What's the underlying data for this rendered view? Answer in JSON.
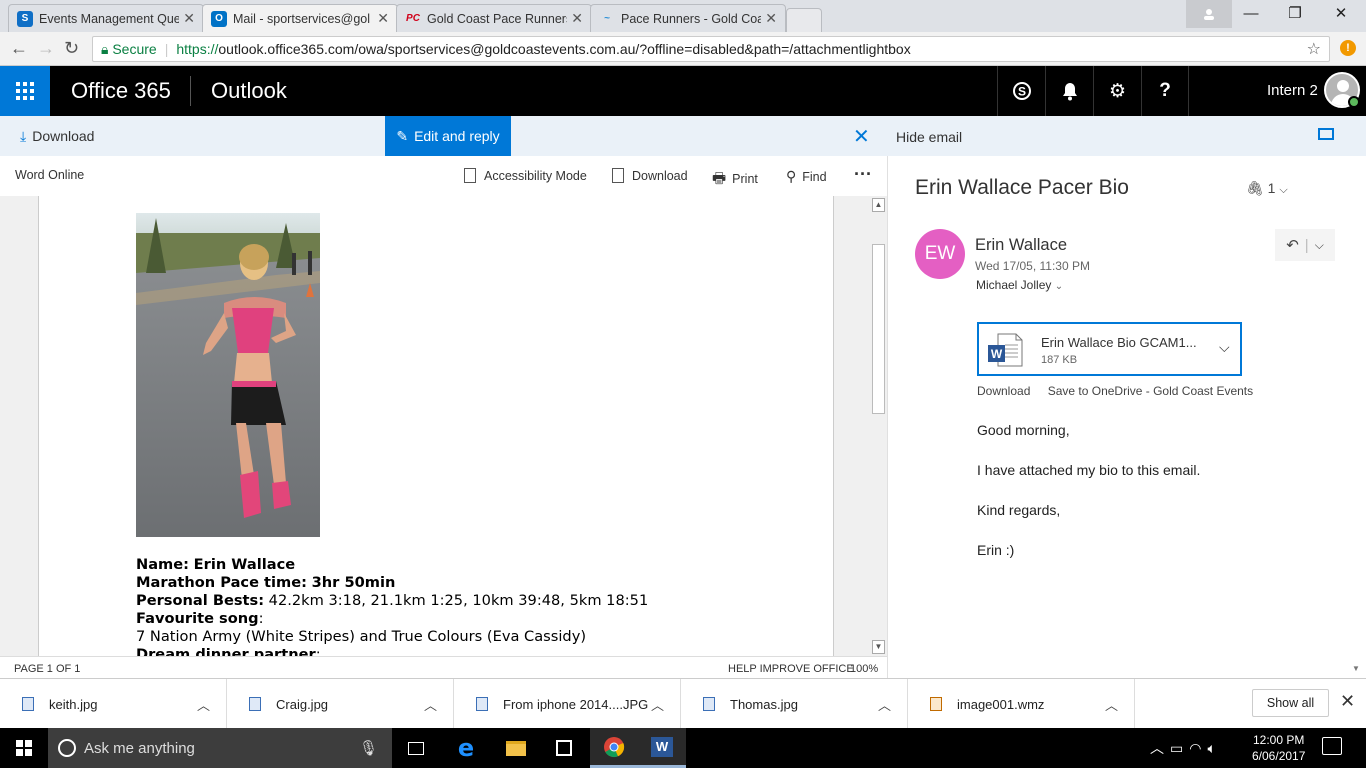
{
  "browser": {
    "tabs": [
      {
        "title": "Events Management Que",
        "favicon_color": "#0f6fc6",
        "favicon_letter": "S"
      },
      {
        "title": "Mail - sportservices@gol",
        "favicon_color": "#0072c6",
        "favicon_letter": "O"
      },
      {
        "title": "Gold Coast Pace Runners",
        "favicon_color": "#d0021b",
        "favicon_letter": "PC"
      },
      {
        "title": "Pace Runners - Gold Coa",
        "favicon_color": "#2a8fd6",
        "favicon_letter": "~"
      }
    ],
    "active_tab_index": 1,
    "secure_label": "Secure",
    "url_proto": "https://",
    "url_rest": "outlook.office365.com/owa/sportservices@goldcoastevents.com.au/?offline=disabled&path=/attachmentlightbox"
  },
  "header": {
    "app_name": "Office 365",
    "module": "Outlook",
    "user_name": "Intern 2"
  },
  "command_bar": {
    "download": "Download",
    "edit_reply": "Edit and reply",
    "hide_email": "Hide email"
  },
  "word": {
    "app_label": "Word Online",
    "accessibility": "Accessibility Mode",
    "download": "Download",
    "print": "Print",
    "find": "Find",
    "page_status": "PAGE 1 OF 1",
    "help": "HELP IMPROVE OFFICE",
    "zoom": "100%",
    "doc": {
      "name_label": "Name:",
      "name_value": "Erin  Wallace",
      "pace_label": "Marathon Pace time:",
      "pace_value": "3hr  50min",
      "pb_label": "Personal Bests:",
      "pb_value": "42.2km 3:18, 21.1km 1:25, 10km 39:48, 5km 18:51",
      "song_label": "Favourite song",
      "song_colon": ":",
      "song_value": "7 Nation Army (White Stripes) and True Colours (Eva Cassidy)",
      "dinner_label": "Dream dinner  partner",
      "dinner_colon": ":"
    }
  },
  "email": {
    "subject": "Erin Wallace Pacer Bio",
    "attachment_count": "1",
    "sender_initials": "EW",
    "sender_color": "#e45fc3",
    "sender": "Erin Wallace",
    "date": "Wed 17/05, 11:30 PM",
    "recipient": "Michael Jolley",
    "attachment": {
      "name": "Erin Wallace Bio GCAM1...",
      "size": "187 KB"
    },
    "att_download": "Download",
    "att_save": "Save to OneDrive - Gold Coast Events",
    "body": [
      "Good morning,",
      "I have attached my bio to this email.",
      "Kind regards,",
      "Erin :)"
    ]
  },
  "downloads": {
    "items": [
      "keith.jpg",
      "Craig.jpg",
      "From iphone 2014....JPG",
      "Thomas.jpg",
      "image001.wmz"
    ],
    "show_all": "Show all"
  },
  "taskbar": {
    "search_placeholder": "Ask me anything",
    "time": "12:00 PM",
    "date": "6/06/2017"
  },
  "colors": {
    "accent": "#0078d7",
    "header_bg": "#000000",
    "cmdbar_bg": "#eaf1f8"
  }
}
